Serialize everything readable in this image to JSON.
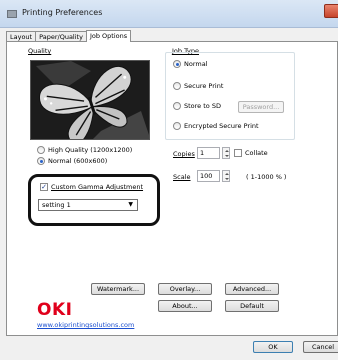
{
  "window": {
    "title": "Printing Preferences"
  },
  "tabs": [
    {
      "label": "Layout"
    },
    {
      "label": "Paper/Quality"
    },
    {
      "label": "Job Options"
    }
  ],
  "quality": {
    "label": "Quality",
    "options": [
      {
        "label": "High Quality (1200x1200)",
        "selected": false
      },
      {
        "label": "Normal (600x600)",
        "selected": true
      }
    ],
    "custom_gamma": {
      "label": "Custom Gamma Adjustment",
      "checked": true
    },
    "gamma_setting": {
      "value": "setting 1"
    }
  },
  "job_type": {
    "label": "Job Type",
    "options": [
      {
        "label": "Normal",
        "selected": true
      },
      {
        "label": "Secure Print",
        "selected": false
      },
      {
        "label": "Store to SD",
        "selected": false
      },
      {
        "label": "Encrypted Secure Print",
        "selected": false
      }
    ],
    "password_button": "Password..."
  },
  "copies": {
    "label": "Copies",
    "value": "1",
    "collate_label": "Collate",
    "collate_checked": false
  },
  "scale": {
    "label": "Scale",
    "value": "100",
    "range": "( 1-1000 % )"
  },
  "buttons": {
    "watermark": "Watermark...",
    "overlay": "Overlay...",
    "advanced": "Advanced...",
    "about": "About...",
    "default": "Default",
    "ok": "OK",
    "cancel": "Cancel"
  },
  "brand": {
    "logo": "OKI",
    "link": "www.okiprintingsolutions.com",
    "color": "#e0001b"
  },
  "colors": {
    "accent": "#2b63c9",
    "link": "#1a4ecf"
  }
}
